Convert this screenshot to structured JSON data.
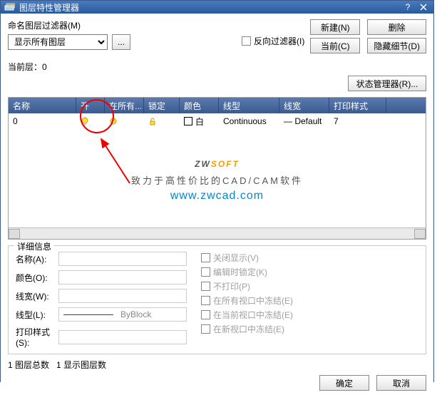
{
  "title": "图层特性管理器",
  "filterLabel": "命名图层过滤器(M)",
  "filterSelected": "显示所有图层",
  "browseBtn": "...",
  "invertFilter": "反向过滤器(I)",
  "btns": {
    "new": "新建(N)",
    "delete": "删除",
    "current": "当前(C)",
    "hide": "隐藏细节(D)",
    "state": "状态管理器(R)..."
  },
  "currentLayerLabel": "当前层：",
  "currentLayer": "0",
  "cols": [
    "名称",
    "开",
    "在所有...",
    "锁定",
    "颜色",
    "线型",
    "线宽",
    "打印样式"
  ],
  "row": {
    "name": "0",
    "color": "白",
    "linetype": "Continuous",
    "lineweight": "Default",
    "plotstyle": "7",
    "lwprefix": "—"
  },
  "wm": {
    "brand1": "ZW",
    "brand2": "SOFT",
    "tag": "致力于高性价比的CAD/CAM软件",
    "url": "www.zwcad.com"
  },
  "details": {
    "title": "详细信息",
    "name": "名称(A):",
    "color": "颜色(O):",
    "lw": "线宽(W):",
    "lt": "线型(L):",
    "ps": "打印样式(S):",
    "ltval": "ByBlock",
    "chk": [
      "关闭显示(V)",
      "编辑时锁定(K)",
      "不打印(P)",
      "在所有视口中冻结(E)",
      "在当前视口中冻结(E)",
      "在新视口中冻结(E)"
    ]
  },
  "status": {
    "total": "1 图层总数",
    "shown": "1 显示图层数"
  },
  "ok": "确定",
  "cancel": "取消"
}
